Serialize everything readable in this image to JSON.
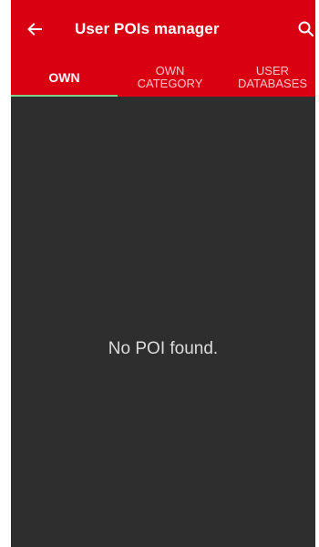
{
  "toolbar": {
    "title": "User POIs manager",
    "back_icon": "arrow-back-icon",
    "search_icon": "search-icon"
  },
  "tabs": [
    {
      "line1": "OWN",
      "line2": "",
      "selected": true
    },
    {
      "line1": "OWN",
      "line2": "CATEGORY",
      "selected": false
    },
    {
      "line1": "USER",
      "line2": "DATABASES",
      "selected": false
    }
  ],
  "content": {
    "empty_message": "No POI found."
  },
  "colors": {
    "app_bar": "#d90012",
    "background": "#2e2e2e",
    "tab_indicator": "#7fd18a",
    "selected_tab_text": "#ffffff",
    "unselected_tab_text": "#f6c5c8"
  }
}
